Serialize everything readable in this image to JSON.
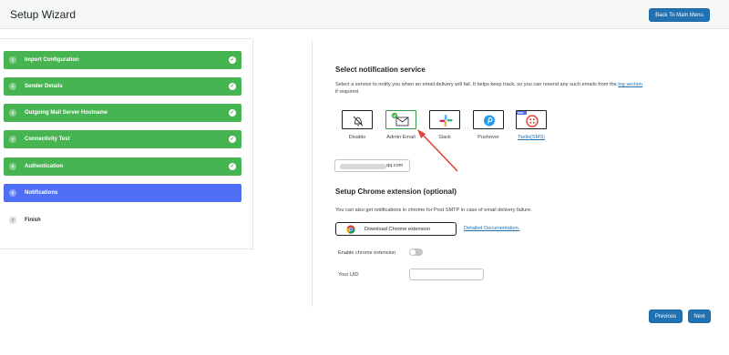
{
  "header": {
    "title": "Setup Wizard",
    "back_button": "Back To Main Menu"
  },
  "steps": [
    {
      "num": "1",
      "label": "Import Configuration",
      "status": "done"
    },
    {
      "num": "2",
      "label": "Sender Details",
      "status": "done"
    },
    {
      "num": "3",
      "label": "Outgoing Mail Server Hostname",
      "status": "done"
    },
    {
      "num": "4",
      "label": "Connectivity Test",
      "status": "done"
    },
    {
      "num": "5",
      "label": "Authentication",
      "status": "done"
    },
    {
      "num": "6",
      "label": "Notifications",
      "status": "current"
    },
    {
      "num": "7",
      "label": "Finish",
      "status": "pending"
    }
  ],
  "notification": {
    "heading": "Select notification service",
    "desc_line1": "Select a service to notify you when an email delivery will fail. It helps keep track, so you can resend any such emails from the",
    "log_link": "log section",
    "desc_line2": "if required.",
    "services": [
      {
        "label": "Disable",
        "icon": "bell-off-icon",
        "selected": false,
        "link": false
      },
      {
        "label": "Admin Email",
        "icon": "envelope-icon",
        "selected": true,
        "link": false
      },
      {
        "label": "Slack",
        "icon": "slack-icon",
        "selected": false,
        "link": false
      },
      {
        "label": "Pushover",
        "icon": "pushover-icon",
        "selected": false,
        "link": false
      },
      {
        "label": "Twilio(SMS)",
        "icon": "twilio-icon",
        "selected": false,
        "link": true,
        "badge": "PRO"
      }
    ],
    "email_suffix": "qq.com"
  },
  "chrome": {
    "heading": "Setup Chrome extension (optional)",
    "desc": "You can also get notifications in chrome for Post SMTP in case of email delivery failure.",
    "download_button": "Download Chrome extension",
    "doc_link": "Detailed Documentation.",
    "enable_label": "Enable chrome extension",
    "enabled": false,
    "uid_label": "Your UID",
    "uid_value": ""
  },
  "footer": {
    "previous": "Previous",
    "next": "Next"
  },
  "colors": {
    "done": "#46b450",
    "current": "#4f6ff5",
    "primary": "#2271b1",
    "arrow": "#e2403a"
  }
}
